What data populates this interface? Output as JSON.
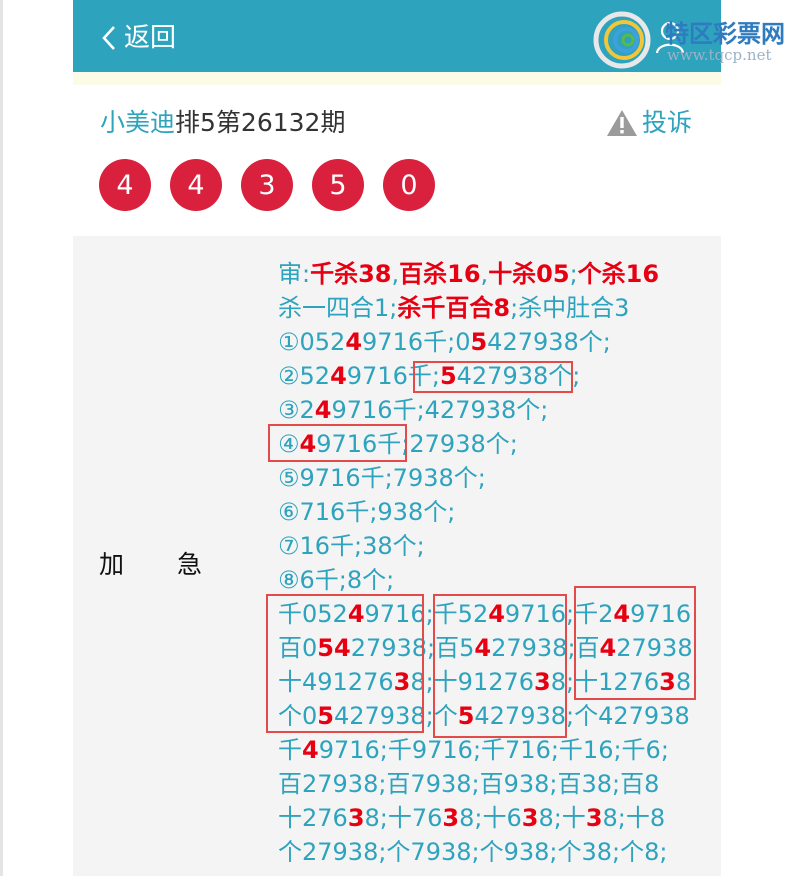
{
  "header": {
    "back_label": "返回",
    "logo_text": "特区彩票网",
    "logo_url": "www.tqcp.net"
  },
  "post": {
    "author": "小美迪",
    "issue": "排5第26132期",
    "complain_label": "投诉",
    "balls": [
      "4",
      "4",
      "3",
      "5",
      "0"
    ]
  },
  "side_label": [
    "加",
    "急"
  ],
  "lines": [
    [
      {
        "t": "审:"
      },
      {
        "t": "千杀38",
        "s": "b"
      },
      {
        "t": ","
      },
      {
        "t": "百杀16",
        "s": "b"
      },
      {
        "t": ","
      },
      {
        "t": "十杀05",
        "s": "b"
      },
      {
        "t": ";"
      },
      {
        "t": "个杀16",
        "s": "b"
      }
    ],
    [
      {
        "t": "杀一四合1;"
      },
      {
        "t": "杀千百合8",
        "s": "b"
      },
      {
        "t": ";杀中肚合3"
      }
    ],
    [
      {
        "t": "①052"
      },
      {
        "t": "4",
        "s": "r"
      },
      {
        "t": "9716千;0"
      },
      {
        "t": "5",
        "s": "r"
      },
      {
        "t": "427938个;"
      }
    ],
    [
      {
        "t": "②52"
      },
      {
        "t": "4",
        "s": "r"
      },
      {
        "t": "9716千;"
      },
      {
        "t": "5",
        "s": "r"
      },
      {
        "t": "427938个;"
      }
    ],
    [
      {
        "t": "③2"
      },
      {
        "t": "4",
        "s": "r"
      },
      {
        "t": "9716千;427938个;"
      }
    ],
    [
      {
        "t": "④"
      },
      {
        "t": "4",
        "s": "r"
      },
      {
        "t": "9716千;27938个;"
      }
    ],
    [
      {
        "t": "⑤9716千;7938个;"
      }
    ],
    [
      {
        "t": "⑥716千;938个;"
      }
    ],
    [
      {
        "t": "⑦16千;38个;"
      }
    ],
    [
      {
        "t": "⑧6千;8个;"
      }
    ],
    [
      {
        "t": "千052"
      },
      {
        "t": "4",
        "s": "r"
      },
      {
        "t": "9716;千52"
      },
      {
        "t": "4",
        "s": "r"
      },
      {
        "t": "9716;千2"
      },
      {
        "t": "4",
        "s": "r"
      },
      {
        "t": "9716"
      }
    ],
    [
      {
        "t": "百0"
      },
      {
        "t": "5",
        "s": "r"
      },
      {
        "t": "4",
        "s": "r"
      },
      {
        "t": "27938;百5"
      },
      {
        "t": "4",
        "s": "r"
      },
      {
        "t": "27938;百"
      },
      {
        "t": "4",
        "s": "r"
      },
      {
        "t": "27938"
      }
    ],
    [
      {
        "t": "十491276"
      },
      {
        "t": "3",
        "s": "r"
      },
      {
        "t": "8;十91276"
      },
      {
        "t": "3",
        "s": "r"
      },
      {
        "t": "8;十1276"
      },
      {
        "t": "3",
        "s": "r"
      },
      {
        "t": "8"
      }
    ],
    [
      {
        "t": "个0"
      },
      {
        "t": "5",
        "s": "r"
      },
      {
        "t": "427938;个"
      },
      {
        "t": "5",
        "s": "r"
      },
      {
        "t": "427938;个427938"
      }
    ],
    [
      {
        "t": "千"
      },
      {
        "t": "4",
        "s": "r"
      },
      {
        "t": "9716;千9716;千716;千16;千6;"
      }
    ],
    [
      {
        "t": "百27938;百7938;百938;百38;百8"
      }
    ],
    [
      {
        "t": "十276"
      },
      {
        "t": "3",
        "s": "r"
      },
      {
        "t": "8;十76"
      },
      {
        "t": "3",
        "s": "r"
      },
      {
        "t": "8;十6"
      },
      {
        "t": "3",
        "s": "r"
      },
      {
        "t": "8;十"
      },
      {
        "t": "3",
        "s": "r"
      },
      {
        "t": "8;十8"
      }
    ],
    [
      {
        "t": "个27938;个7938;个938;个38;个8;"
      }
    ]
  ],
  "colors": {
    "header": "#2da3be",
    "accent": "#2da3be",
    "ball": "#d9203d",
    "highlight": "#e60012",
    "annotation_box": "#e34a4a"
  }
}
